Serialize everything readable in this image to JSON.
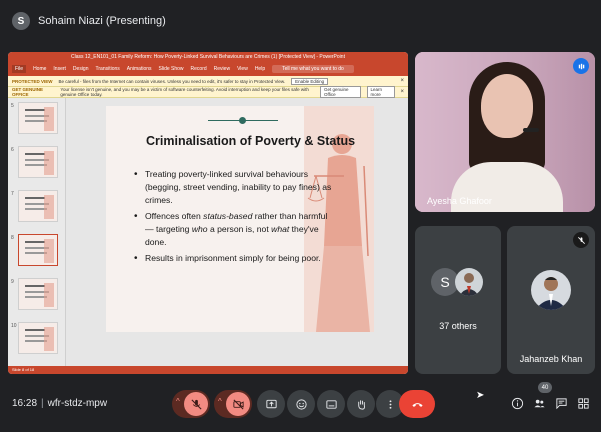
{
  "header": {
    "presenter_initial": "S",
    "title": "Sohaim Niazi (Presenting)"
  },
  "ppt": {
    "window_title": "Class 12_EN101_01 Family Reform: How Poverty-Linked Survival Behaviours are Crimes (1) [Protected View] - PowerPoint",
    "ribbon_tabs": [
      "File",
      "Home",
      "Insert",
      "Design",
      "Transitions",
      "Animations",
      "Slide Show",
      "Record",
      "Review",
      "View",
      "Help"
    ],
    "search_placeholder": "Tell me what you want to do",
    "notice_protected": {
      "label": "PROTECTED VIEW",
      "text": "Be careful - files from the Internet can contain viruses. Unless you need to edit, it's safer to stay in Protected View.",
      "button": "Enable Editing"
    },
    "notice_genuine": {
      "label": "GET GENUINE OFFICE",
      "text": "Your license isn't genuine, and you may be a victim of software counterfeiting. Avoid interruption and keep your files safe with genuine Office today.",
      "button1": "Get genuine Office",
      "button2": "Learn more"
    },
    "thumb_numbers": [
      "5",
      "6",
      "7",
      "8",
      "9",
      "10"
    ],
    "status_text": "Slide 8 of 18",
    "slide": {
      "title": "Criminalisation of Poverty & Status",
      "bullet1": "Treating poverty-linked survival behaviours (begging, street vending, inability to pay fines) as crimes.",
      "bullet2_a": "Offences often ",
      "bullet2_em1": "status-based",
      "bullet2_b": " rather than harmful — targeting ",
      "bullet2_em2": "who",
      "bullet2_c": " a person is, not ",
      "bullet2_em3": "what",
      "bullet2_d": " they've done.",
      "bullet3": "Results in imprisonment simply for being poor."
    }
  },
  "tiles": {
    "main": {
      "name": "Ayesha Ghafoor"
    },
    "others": {
      "initial": "S",
      "label": "37 others"
    },
    "jk": {
      "name": "Jahanzeb Khan"
    }
  },
  "bottom": {
    "time": "16:28",
    "meeting_code": "wfr-stdz-mpw",
    "people_count": "40"
  },
  "colors": {
    "accent": "#c8472d",
    "leave": "#ea4335",
    "muted": "#f28b82"
  }
}
